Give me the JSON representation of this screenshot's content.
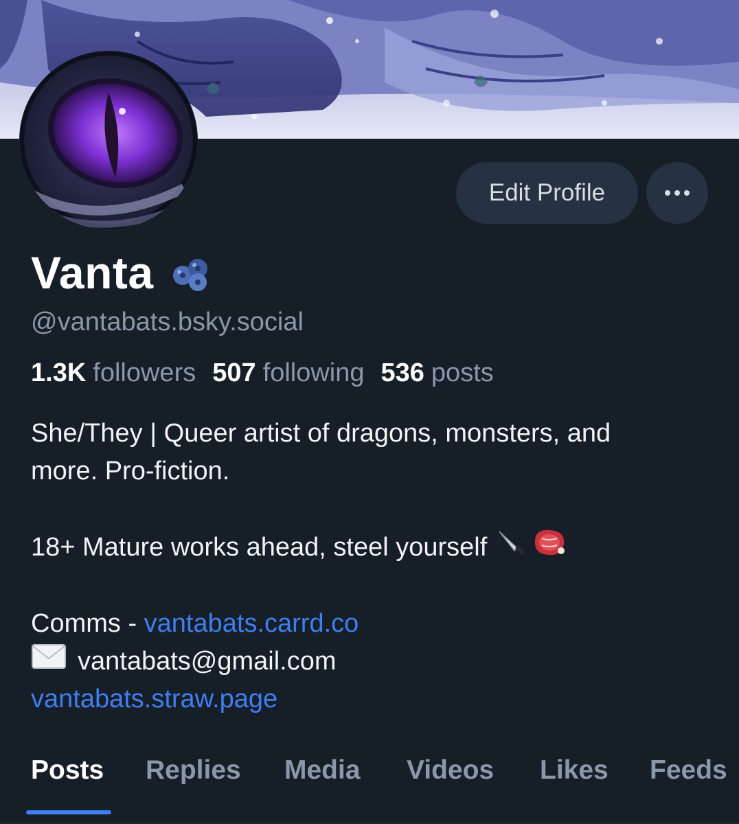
{
  "profile": {
    "display_name": "Vanta",
    "name_emoji": "blueberries-emoji",
    "handle": "@vantabats.bsky.social",
    "stats": {
      "followers_count": "1.3K",
      "followers_label": "followers",
      "following_count": "507",
      "following_label": "following",
      "posts_count": "536",
      "posts_label": "posts"
    },
    "bio": {
      "line1": "She/They | Queer artist of dragons, monsters, and",
      "line2": "more. Pro-fiction.",
      "line3": "18+ Mature works ahead, steel yourself",
      "line3_icons": [
        "knife-emoji",
        "meat-emoji"
      ],
      "comms_prefix": "Comms - ",
      "comms_link": "vantabats.carrd.co",
      "email_icon": "envelope-emoji",
      "email": "vantabats@gmail.com",
      "straw_link": "vantabats.straw.page"
    }
  },
  "actions": {
    "edit_label": "Edit Profile",
    "more_icon": "ellipsis-icon"
  },
  "tabs": [
    {
      "label": "Posts",
      "active": true
    },
    {
      "label": "Replies"
    },
    {
      "label": "Media"
    },
    {
      "label": "Videos"
    },
    {
      "label": "Likes"
    },
    {
      "label": "Feeds"
    }
  ],
  "colors": {
    "background": "#161e27",
    "link": "#3f7ef0",
    "muted": "#8a98a9",
    "button": "#263241"
  }
}
